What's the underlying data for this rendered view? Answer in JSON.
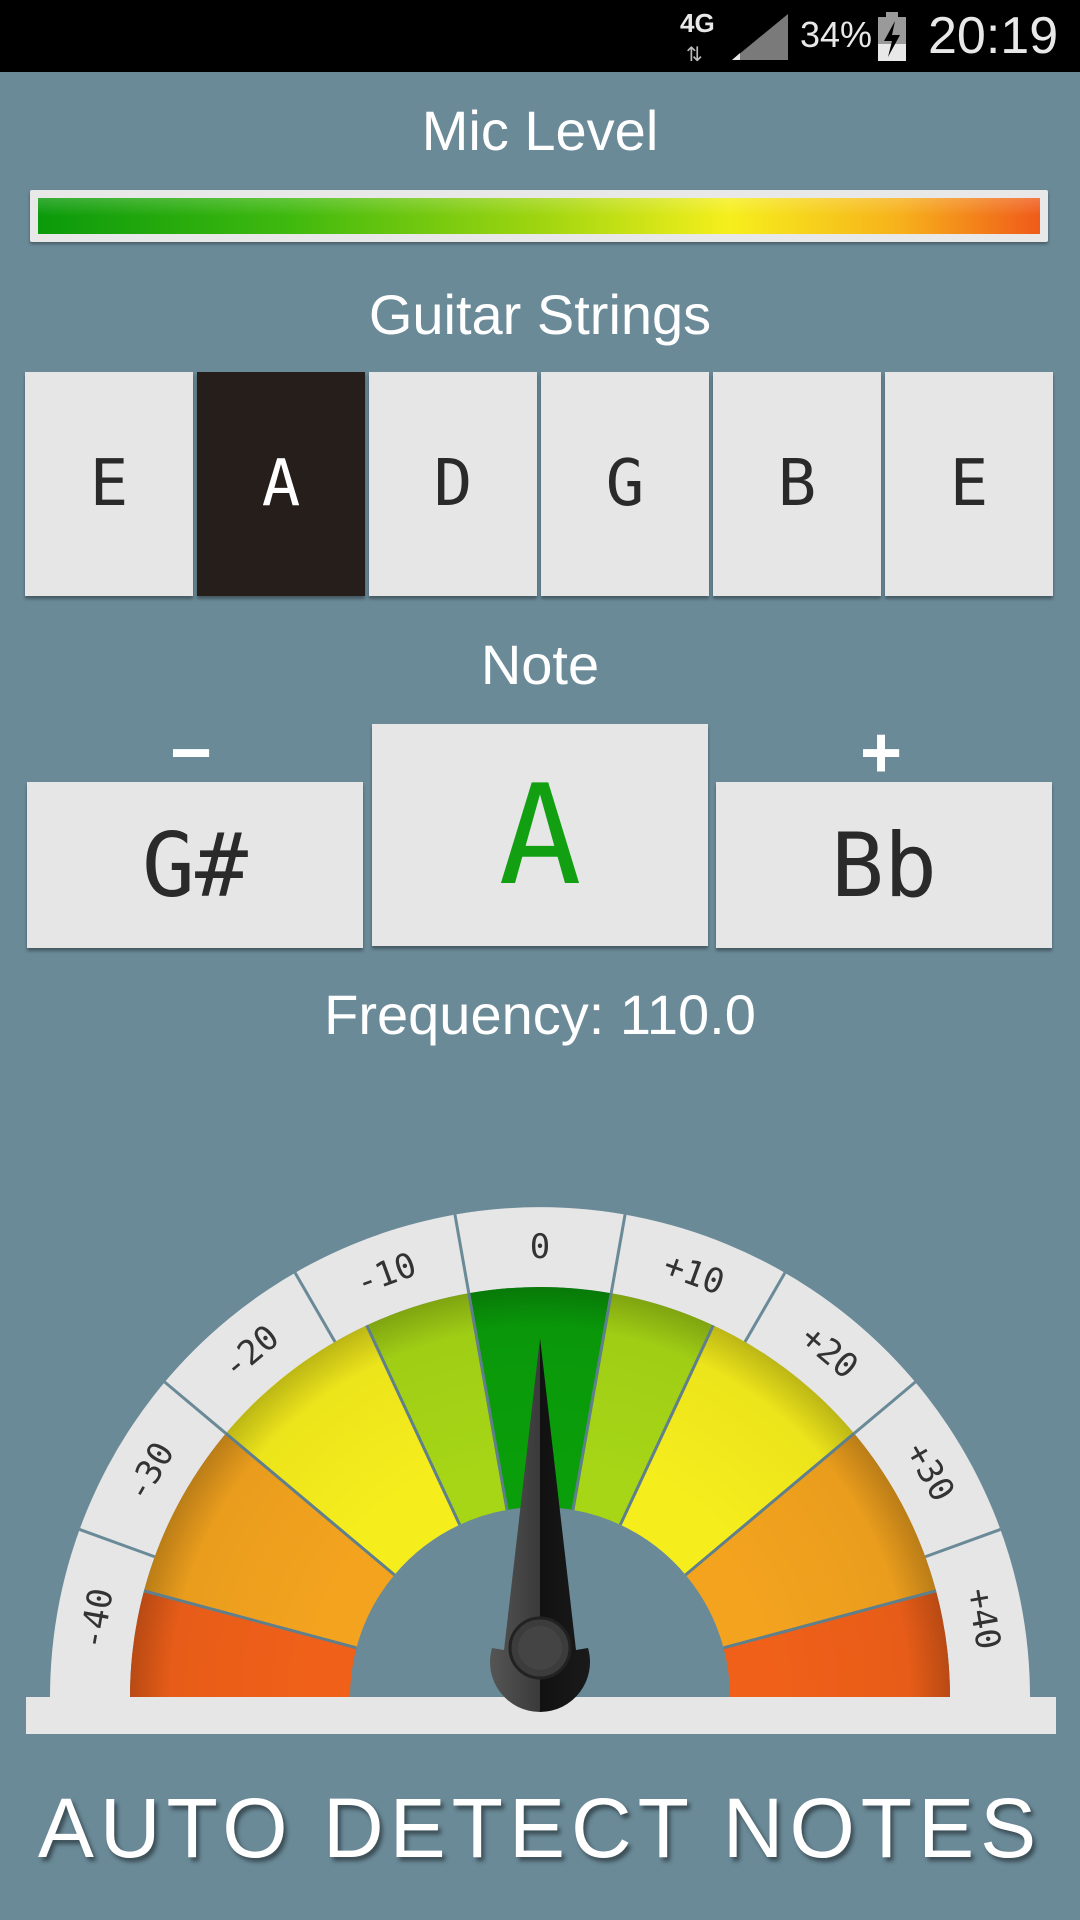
{
  "status_bar": {
    "network": "4G",
    "battery_percent": "34%",
    "time": "20:19"
  },
  "mic_level": {
    "title": "Mic Level",
    "level": 1.0
  },
  "guitar_strings": {
    "title": "Guitar Strings",
    "strings": [
      "E",
      "A",
      "D",
      "G",
      "B",
      "E"
    ],
    "selected_index": 1
  },
  "note": {
    "title": "Note",
    "minus_label": "−",
    "plus_label": "+",
    "previous": "G#",
    "current": "A",
    "next": "Bb"
  },
  "frequency": {
    "label": "Frequency: 110.0"
  },
  "tuning_meter": {
    "scale_labels": [
      "-40",
      "-30",
      "-20",
      "-10",
      "0",
      "+10",
      "+20",
      "+30",
      "+40"
    ],
    "cents_offset": 0,
    "colors": {
      "center": "#0a9e0a",
      "near": "#a6d616",
      "mid": "#f6ee1c",
      "far": "#f3a31e",
      "extreme": "#f06019"
    }
  },
  "auto_detect": {
    "label": "AUTO DETECT NOTES"
  }
}
